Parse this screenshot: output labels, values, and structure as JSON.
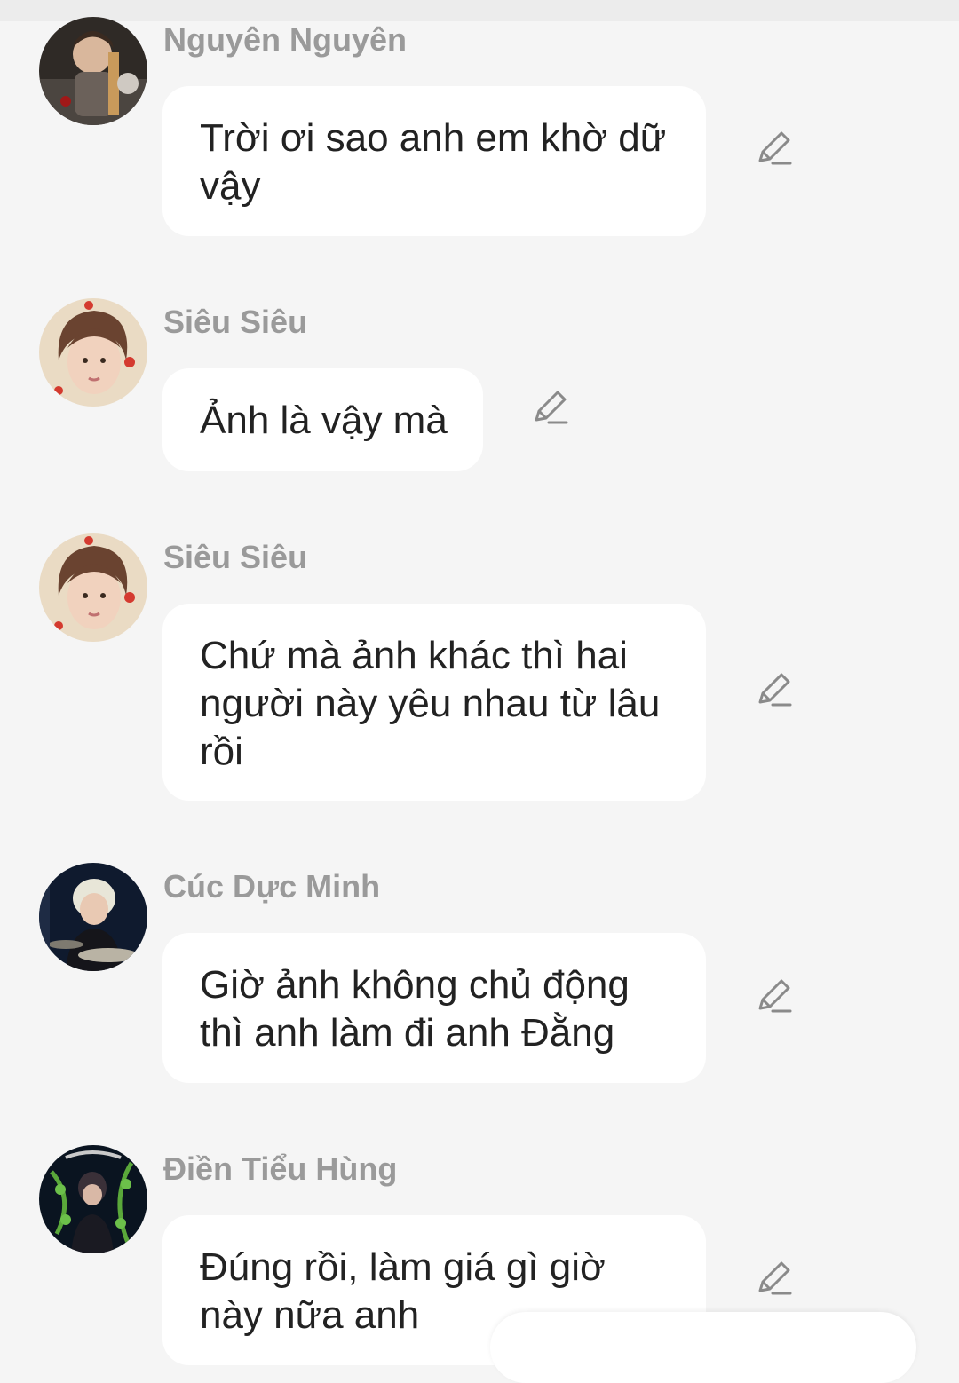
{
  "messages": [
    {
      "sender": "Nguyên Nguyên",
      "text": "Trời ơi sao anh em khờ dữ vậy"
    },
    {
      "sender": "Siêu Siêu",
      "text": "Ảnh là vậy mà"
    },
    {
      "sender": "Siêu Siêu",
      "text": "Chứ mà ảnh khác thì hai người này yêu nhau từ lâu rồi"
    },
    {
      "sender": "Cúc Dực Minh",
      "text": "Giờ ảnh không chủ động thì anh làm đi anh Đằng"
    },
    {
      "sender": "Điền Tiểu Hùng",
      "text": "Đúng rồi, làm giá gì giờ này nữa anh"
    }
  ],
  "icons": {
    "edit": "pencil-edit-icon"
  },
  "colors": {
    "background": "#f5f5f5",
    "bubble": "#ffffff",
    "sender": "#9a9a9a",
    "text": "#222222",
    "icon": "#8a8a8a"
  }
}
